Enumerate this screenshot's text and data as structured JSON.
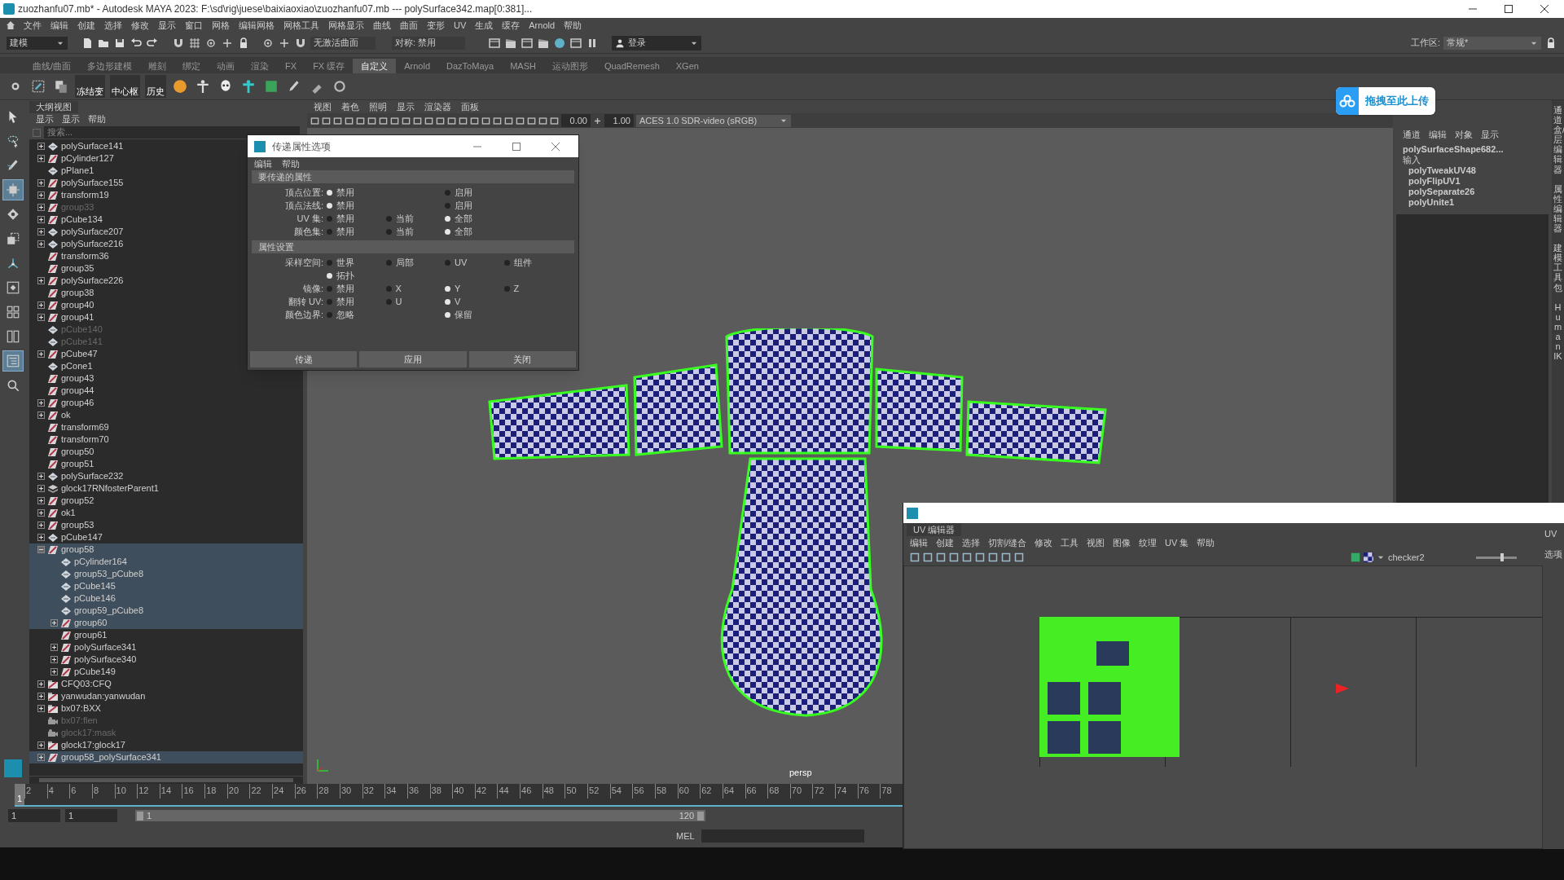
{
  "window": {
    "title": "zuozhanfu07.mb* - Autodesk MAYA 2023: F:\\sd\\rig\\juese\\baixiaoxiao\\zuozhanfu07.mb  ---  polySurface342.map[0:381]..."
  },
  "menu_bar": [
    "文件",
    "编辑",
    "创建",
    "选择",
    "修改",
    "显示",
    "窗口",
    "网格",
    "编辑网格",
    "网格工具",
    "网格显示",
    "曲线",
    "曲面",
    "变形",
    "UV",
    "生成",
    "缓存",
    "Arnold",
    "帮助"
  ],
  "status_line": {
    "menu_set": "建模",
    "live_surface": "无激活曲面",
    "symmetry": "对称: 禁用",
    "sign_in": "登录",
    "workspace_label": "工作区:",
    "workspace": "常规*"
  },
  "shelf_tabs": [
    {
      "label": "曲线/曲面",
      "selected": false
    },
    {
      "label": "多边形建模",
      "selected": false
    },
    {
      "label": "雕刻",
      "selected": false
    },
    {
      "label": "绑定",
      "selected": false
    },
    {
      "label": "动画",
      "selected": false
    },
    {
      "label": "渲染",
      "selected": false
    },
    {
      "label": "FX",
      "selected": false
    },
    {
      "label": "FX 缓存",
      "selected": false
    },
    {
      "label": "自定义",
      "selected": true
    },
    {
      "label": "Arnold",
      "selected": false
    },
    {
      "label": "DazToMaya",
      "selected": false
    },
    {
      "label": "MASH",
      "selected": false
    },
    {
      "label": "运动图形",
      "selected": false
    },
    {
      "label": "QuadRemesh",
      "selected": false
    },
    {
      "label": "XGen",
      "selected": false
    }
  ],
  "shelf_labels": [
    "冻结变",
    "中心枢",
    "历史"
  ],
  "upload_badge": "拖拽至此上传",
  "toolbox": [
    {
      "kind": "select",
      "selected": false
    },
    {
      "kind": "lasso",
      "selected": false
    },
    {
      "kind": "paint",
      "selected": false
    },
    {
      "kind": "move",
      "selected": true
    },
    {
      "kind": "rotate",
      "selected": false
    },
    {
      "kind": "scale",
      "selected": false
    },
    {
      "kind": "pivot",
      "selected": false
    },
    {
      "kind": "single",
      "selected": false
    },
    {
      "kind": "quad",
      "selected": false
    },
    {
      "kind": "split",
      "selected": false
    },
    {
      "kind": "outliner",
      "selected": true
    },
    {
      "kind": "search",
      "selected": false
    }
  ],
  "outliner": {
    "title": "大纲视图",
    "menu": [
      "显示",
      "显示",
      "帮助"
    ],
    "search": {
      "placeholder": "搜索..."
    },
    "items": [
      {
        "name": "polySurface141",
        "kind": "mesh",
        "expandable": true,
        "expanded": false,
        "dimmed": false,
        "selected": false
      },
      {
        "name": "pCylinder127",
        "kind": "transform",
        "expandable": true,
        "expanded": false,
        "dimmed": false,
        "selected": false
      },
      {
        "name": "pPlane1",
        "kind": "mesh",
        "expandable": false,
        "dimmed": false,
        "selected": false
      },
      {
        "name": "polySurface155",
        "kind": "transform",
        "expandable": true,
        "expanded": false,
        "dimmed": false,
        "selected": false
      },
      {
        "name": "transform19",
        "kind": "transform",
        "expandable": true,
        "expanded": false,
        "dimmed": false,
        "selected": false
      },
      {
        "name": "group33",
        "kind": "transform",
        "expandable": true,
        "expanded": false,
        "dimmed": true,
        "selected": false
      },
      {
        "name": "pCube134",
        "kind": "transform",
        "expandable": true,
        "expanded": false,
        "dimmed": false,
        "selected": false
      },
      {
        "name": "polySurface207",
        "kind": "mesh",
        "expandable": true,
        "expanded": false,
        "dimmed": false,
        "selected": false
      },
      {
        "name": "polySurface216",
        "kind": "mesh",
        "expandable": true,
        "expanded": false,
        "dimmed": false,
        "selected": false
      },
      {
        "name": "transform36",
        "kind": "transform",
        "expandable": false,
        "dimmed": false,
        "selected": false
      },
      {
        "name": "group35",
        "kind": "transform",
        "expandable": false,
        "dimmed": false,
        "selected": false
      },
      {
        "name": "polySurface226",
        "kind": "transform",
        "expandable": true,
        "expanded": false,
        "dimmed": false,
        "selected": false
      },
      {
        "name": "group38",
        "kind": "transform",
        "expandable": false,
        "dimmed": false,
        "selected": false
      },
      {
        "name": "group40",
        "kind": "transform",
        "expandable": true,
        "expanded": false,
        "dimmed": false,
        "selected": false
      },
      {
        "name": "group41",
        "kind": "transform",
        "expandable": true,
        "expanded": false,
        "dimmed": false,
        "selected": false
      },
      {
        "name": "pCube140",
        "kind": "mesh",
        "expandable": false,
        "dimmed": true,
        "selected": false
      },
      {
        "name": "pCube141",
        "kind": "mesh",
        "expandable": false,
        "dimmed": true,
        "selected": false
      },
      {
        "name": "pCube47",
        "kind": "transform",
        "expandable": true,
        "expanded": false,
        "dimmed": false,
        "selected": false
      },
      {
        "name": "pCone1",
        "kind": "mesh",
        "expandable": false,
        "dimmed": false,
        "selected": false
      },
      {
        "name": "group43",
        "kind": "transform",
        "expandable": false,
        "dimmed": false,
        "selected": false
      },
      {
        "name": "group44",
        "kind": "transform",
        "expandable": false,
        "dimmed": false,
        "selected": false
      },
      {
        "name": "group46",
        "kind": "transform",
        "expandable": true,
        "expanded": false,
        "dimmed": false,
        "selected": false
      },
      {
        "name": "ok",
        "kind": "transform",
        "expandable": true,
        "expanded": false,
        "dimmed": false,
        "selected": false
      },
      {
        "name": "transform69",
        "kind": "transform",
        "expandable": false,
        "dimmed": false,
        "selected": false
      },
      {
        "name": "transform70",
        "kind": "transform",
        "expandable": false,
        "dimmed": false,
        "selected": false
      },
      {
        "name": "group50",
        "kind": "transform",
        "expandable": false,
        "dimmed": false,
        "selected": false
      },
      {
        "name": "group51",
        "kind": "transform",
        "expandable": false,
        "dimmed": false,
        "selected": false
      },
      {
        "name": "polySurface232",
        "kind": "mesh",
        "expandable": true,
        "expanded": false,
        "dimmed": false,
        "selected": false
      },
      {
        "name": "glock17RNfosterParent1",
        "kind": "foster",
        "expandable": true,
        "expanded": false,
        "dimmed": false,
        "selected": false
      },
      {
        "name": "group52",
        "kind": "transform",
        "expandable": true,
        "expanded": false,
        "dimmed": false,
        "selected": false
      },
      {
        "name": "ok1",
        "kind": "transform",
        "expandable": true,
        "expanded": false,
        "dimmed": false,
        "selected": false
      },
      {
        "name": "group53",
        "kind": "transform",
        "expandable": true,
        "expanded": false,
        "dimmed": false,
        "selected": false
      },
      {
        "name": "pCube147",
        "kind": "mesh",
        "expandable": true,
        "expanded": false,
        "dimmed": false,
        "selected": false
      },
      {
        "name": "group58",
        "kind": "transform",
        "expandable": true,
        "expanded": true,
        "dimmed": false,
        "selected": true,
        "children": [
          {
            "name": "pCylinder164",
            "kind": "mesh",
            "expandable": false,
            "dimmed": false,
            "selected": true
          },
          {
            "name": "group53_pCube8",
            "kind": "mesh",
            "expandable": false,
            "dimmed": false,
            "selected": true
          },
          {
            "name": "pCube145",
            "kind": "mesh",
            "expandable": false,
            "dimmed": false,
            "selected": true
          },
          {
            "name": "pCube146",
            "kind": "mesh",
            "expandable": false,
            "dimmed": false,
            "selected": true
          },
          {
            "name": "group59_pCube8",
            "kind": "mesh",
            "expandable": false,
            "dimmed": false,
            "selected": true
          },
          {
            "name": "group60",
            "kind": "transform",
            "expandable": true,
            "expanded": false,
            "dimmed": false,
            "selected": true
          },
          {
            "name": "group61",
            "kind": "transform",
            "expandable": false,
            "dimmed": false,
            "selected": false
          },
          {
            "name": "polySurface341",
            "kind": "transform",
            "expandable": true,
            "expanded": false,
            "dimmed": false,
            "selected": false
          },
          {
            "name": "polySurface340",
            "kind": "transform",
            "expandable": true,
            "expanded": false,
            "dimmed": false,
            "selected": false
          },
          {
            "name": "pCube149",
            "kind": "transform",
            "expandable": true,
            "expanded": false,
            "dimmed": false,
            "selected": false
          }
        ]
      },
      {
        "name": "CFQ03:CFQ",
        "kind": "reference",
        "expandable": true,
        "expanded": false,
        "dimmed": false,
        "selected": false
      },
      {
        "name": "yanwudan:yanwudan",
        "kind": "reference",
        "expandable": true,
        "expanded": false,
        "dimmed": false,
        "selected": false
      },
      {
        "name": "bx07:BXX",
        "kind": "reference",
        "expandable": true,
        "expanded": false,
        "dimmed": false,
        "selected": false
      },
      {
        "name": "bx07:flen",
        "kind": "camera",
        "expandable": false,
        "dimmed": true,
        "selected": false
      },
      {
        "name": "glock17:mask",
        "kind": "camera",
        "expandable": false,
        "dimmed": true,
        "selected": false
      },
      {
        "name": "glock17:glock17",
        "kind": "reference",
        "expandable": true,
        "expanded": false,
        "dimmed": false,
        "selected": false
      },
      {
        "name": "group58_polySurface341",
        "kind": "transform",
        "expandable": true,
        "expanded": false,
        "dimmed": false,
        "selected": true
      }
    ]
  },
  "viewport": {
    "menu": [
      "视图",
      "着色",
      "照明",
      "显示",
      "渲染器",
      "面板"
    ],
    "exposure": "0.00",
    "gamma": "1.00",
    "color_space": "ACES 1.0 SDR-video (sRGB)",
    "camera_label": "persp"
  },
  "channel_box": {
    "menu": [
      "通道",
      "编辑",
      "对象",
      "显示"
    ],
    "shape": "polySurfaceShape682...",
    "inputs_label": "输入",
    "inputs": [
      "polyTweakUV48",
      "polyFlipUV1",
      "polySeparate26",
      "polyUnite1"
    ]
  },
  "side_tabs": [
    "通道盒/层编辑器",
    "属性编辑器",
    "建模工具包",
    "Human IK"
  ],
  "transfer_dialog": {
    "title": "传递属性选项",
    "menu": [
      "编辑",
      "帮助"
    ],
    "sections": [
      {
        "title": "要传递的属性",
        "rows": [
          {
            "label": "顶点位置:",
            "options": [
              {
                "label": "禁用",
                "selected": true
              },
              {
                "label": "启用",
                "selected": false
              }
            ]
          },
          {
            "label": "顶点法线:",
            "options": [
              {
                "label": "禁用",
                "selected": true
              },
              {
                "label": "启用",
                "selected": false
              }
            ]
          },
          {
            "label": "UV 集:",
            "options": [
              {
                "label": "禁用",
                "selected": false
              },
              {
                "label": "当前",
                "selected": false
              },
              {
                "label": "全部",
                "selected": true
              }
            ]
          },
          {
            "label": "颜色集:",
            "options": [
              {
                "label": "禁用",
                "selected": false
              },
              {
                "label": "当前",
                "selected": false
              },
              {
                "label": "全部",
                "selected": true
              }
            ]
          }
        ]
      },
      {
        "title": "属性设置",
        "rows": [
          {
            "label": "采样空间:",
            "options": [
              {
                "label": "世界",
                "selected": false
              },
              {
                "label": "局部",
                "selected": false
              },
              {
                "label": "UV",
                "selected": false
              },
              {
                "label": "组件",
                "selected": false
              },
              {
                "label": "拓扑",
                "selected": true
              }
            ]
          },
          {
            "label": "镜像:",
            "options": [
              {
                "label": "禁用",
                "selected": false
              },
              {
                "label": "X",
                "selected": false
              },
              {
                "label": "Y",
                "selected": true
              },
              {
                "label": "Z",
                "selected": false
              }
            ]
          },
          {
            "label": "翻转 UV:",
            "options": [
              {
                "label": "禁用",
                "selected": false
              },
              {
                "label": "U",
                "selected": false
              },
              {
                "label": "V",
                "selected": true
              }
            ]
          },
          {
            "label": "颜色边界:",
            "options": [
              {
                "label": "忽略",
                "selected": false
              },
              {
                "label": "保留",
                "selected": true
              }
            ]
          }
        ]
      }
    ],
    "buttons": [
      "传递",
      "应用",
      "关闭"
    ]
  },
  "uv_editor": {
    "tab": "UV 编辑器",
    "menu": [
      "编辑",
      "创建",
      "选择",
      "切割/缝合",
      "修改",
      "工具",
      "视图",
      "图像",
      "纹理",
      "UV 集",
      "帮助"
    ],
    "texture": "checker2",
    "zoom": {
      "level": 0.6
    },
    "side_labels": [
      "UV",
      "选项"
    ]
  },
  "timeline": {
    "current": "1",
    "ticks": [
      "2",
      "4",
      "6",
      "8",
      "10",
      "12",
      "14",
      "16",
      "18",
      "20",
      "22",
      "24",
      "26",
      "28",
      "30",
      "32",
      "34",
      "36",
      "38",
      "40",
      "42",
      "44",
      "46",
      "48",
      "50",
      "52",
      "54",
      "56",
      "58",
      "60",
      "62",
      "64",
      "66",
      "68",
      "70",
      "72",
      "74",
      "76",
      "78"
    ]
  },
  "range": {
    "start": "1",
    "playback_start": "1",
    "range_start": "1",
    "range_end": "120",
    "level": 1
  },
  "command_line": {
    "language": "MEL"
  }
}
